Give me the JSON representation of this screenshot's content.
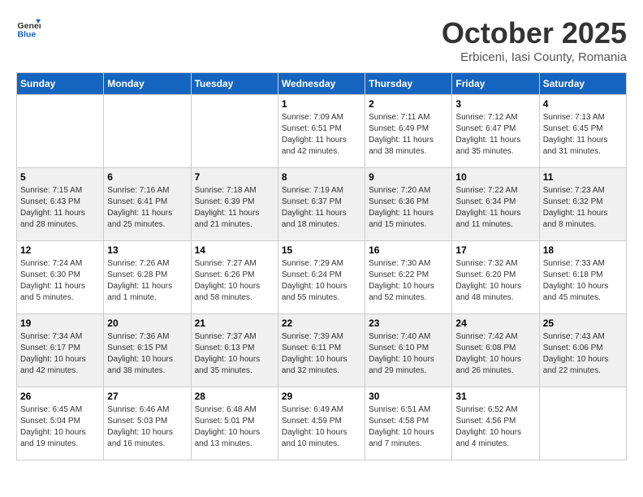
{
  "header": {
    "logo_general": "General",
    "logo_blue": "Blue",
    "month_title": "October 2025",
    "location": "Erbiceni, Iasi County, Romania"
  },
  "weekdays": [
    "Sunday",
    "Monday",
    "Tuesday",
    "Wednesday",
    "Thursday",
    "Friday",
    "Saturday"
  ],
  "weeks": [
    [
      {
        "day": "",
        "info": ""
      },
      {
        "day": "",
        "info": ""
      },
      {
        "day": "",
        "info": ""
      },
      {
        "day": "1",
        "info": "Sunrise: 7:09 AM\nSunset: 6:51 PM\nDaylight: 11 hours\nand 42 minutes."
      },
      {
        "day": "2",
        "info": "Sunrise: 7:11 AM\nSunset: 6:49 PM\nDaylight: 11 hours\nand 38 minutes."
      },
      {
        "day": "3",
        "info": "Sunrise: 7:12 AM\nSunset: 6:47 PM\nDaylight: 11 hours\nand 35 minutes."
      },
      {
        "day": "4",
        "info": "Sunrise: 7:13 AM\nSunset: 6:45 PM\nDaylight: 11 hours\nand 31 minutes."
      }
    ],
    [
      {
        "day": "5",
        "info": "Sunrise: 7:15 AM\nSunset: 6:43 PM\nDaylight: 11 hours\nand 28 minutes."
      },
      {
        "day": "6",
        "info": "Sunrise: 7:16 AM\nSunset: 6:41 PM\nDaylight: 11 hours\nand 25 minutes."
      },
      {
        "day": "7",
        "info": "Sunrise: 7:18 AM\nSunset: 6:39 PM\nDaylight: 11 hours\nand 21 minutes."
      },
      {
        "day": "8",
        "info": "Sunrise: 7:19 AM\nSunset: 6:37 PM\nDaylight: 11 hours\nand 18 minutes."
      },
      {
        "day": "9",
        "info": "Sunrise: 7:20 AM\nSunset: 6:36 PM\nDaylight: 11 hours\nand 15 minutes."
      },
      {
        "day": "10",
        "info": "Sunrise: 7:22 AM\nSunset: 6:34 PM\nDaylight: 11 hours\nand 11 minutes."
      },
      {
        "day": "11",
        "info": "Sunrise: 7:23 AM\nSunset: 6:32 PM\nDaylight: 11 hours\nand 8 minutes."
      }
    ],
    [
      {
        "day": "12",
        "info": "Sunrise: 7:24 AM\nSunset: 6:30 PM\nDaylight: 11 hours\nand 5 minutes."
      },
      {
        "day": "13",
        "info": "Sunrise: 7:26 AM\nSunset: 6:28 PM\nDaylight: 11 hours\nand 1 minute."
      },
      {
        "day": "14",
        "info": "Sunrise: 7:27 AM\nSunset: 6:26 PM\nDaylight: 10 hours\nand 58 minutes."
      },
      {
        "day": "15",
        "info": "Sunrise: 7:29 AM\nSunset: 6:24 PM\nDaylight: 10 hours\nand 55 minutes."
      },
      {
        "day": "16",
        "info": "Sunrise: 7:30 AM\nSunset: 6:22 PM\nDaylight: 10 hours\nand 52 minutes."
      },
      {
        "day": "17",
        "info": "Sunrise: 7:32 AM\nSunset: 6:20 PM\nDaylight: 10 hours\nand 48 minutes."
      },
      {
        "day": "18",
        "info": "Sunrise: 7:33 AM\nSunset: 6:18 PM\nDaylight: 10 hours\nand 45 minutes."
      }
    ],
    [
      {
        "day": "19",
        "info": "Sunrise: 7:34 AM\nSunset: 6:17 PM\nDaylight: 10 hours\nand 42 minutes."
      },
      {
        "day": "20",
        "info": "Sunrise: 7:36 AM\nSunset: 6:15 PM\nDaylight: 10 hours\nand 38 minutes."
      },
      {
        "day": "21",
        "info": "Sunrise: 7:37 AM\nSunset: 6:13 PM\nDaylight: 10 hours\nand 35 minutes."
      },
      {
        "day": "22",
        "info": "Sunrise: 7:39 AM\nSunset: 6:11 PM\nDaylight: 10 hours\nand 32 minutes."
      },
      {
        "day": "23",
        "info": "Sunrise: 7:40 AM\nSunset: 6:10 PM\nDaylight: 10 hours\nand 29 minutes."
      },
      {
        "day": "24",
        "info": "Sunrise: 7:42 AM\nSunset: 6:08 PM\nDaylight: 10 hours\nand 26 minutes."
      },
      {
        "day": "25",
        "info": "Sunrise: 7:43 AM\nSunset: 6:06 PM\nDaylight: 10 hours\nand 22 minutes."
      }
    ],
    [
      {
        "day": "26",
        "info": "Sunrise: 6:45 AM\nSunset: 5:04 PM\nDaylight: 10 hours\nand 19 minutes."
      },
      {
        "day": "27",
        "info": "Sunrise: 6:46 AM\nSunset: 5:03 PM\nDaylight: 10 hours\nand 16 minutes."
      },
      {
        "day": "28",
        "info": "Sunrise: 6:48 AM\nSunset: 5:01 PM\nDaylight: 10 hours\nand 13 minutes."
      },
      {
        "day": "29",
        "info": "Sunrise: 6:49 AM\nSunset: 4:59 PM\nDaylight: 10 hours\nand 10 minutes."
      },
      {
        "day": "30",
        "info": "Sunrise: 6:51 AM\nSunset: 4:58 PM\nDaylight: 10 hours\nand 7 minutes."
      },
      {
        "day": "31",
        "info": "Sunrise: 6:52 AM\nSunset: 4:56 PM\nDaylight: 10 hours\nand 4 minutes."
      },
      {
        "day": "",
        "info": ""
      }
    ]
  ]
}
